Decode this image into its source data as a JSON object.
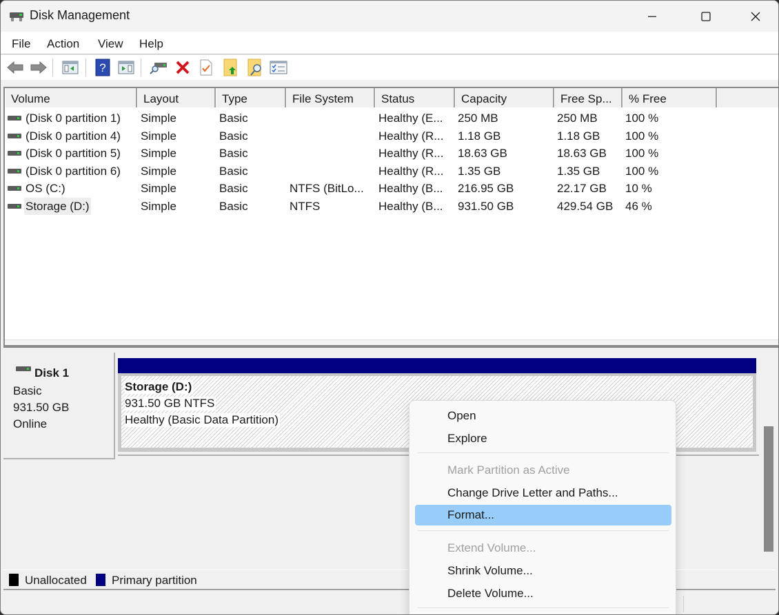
{
  "window": {
    "title": "Disk Management",
    "controls": {
      "minimize": "minimize",
      "maximize": "maximize",
      "close": "close"
    }
  },
  "menubar": {
    "items": [
      {
        "label": "File"
      },
      {
        "label": "Action"
      },
      {
        "label": "View"
      },
      {
        "label": "Help"
      }
    ]
  },
  "toolbar": {
    "buttons": [
      {
        "icon": "back-arrow-icon",
        "tooltip": "Back"
      },
      {
        "icon": "forward-arrow-icon",
        "tooltip": "Forward"
      },
      {
        "icon": "show-hide-console-tree-icon"
      },
      {
        "icon": "help-icon"
      },
      {
        "icon": "show-hide-action-pane-icon"
      },
      {
        "icon": "connect-drive-icon"
      },
      {
        "icon": "delete-icon"
      },
      {
        "icon": "properties-icon"
      },
      {
        "icon": "open-folder-up-icon"
      },
      {
        "icon": "explore-folder-search-icon"
      },
      {
        "icon": "checklist-icon"
      }
    ]
  },
  "volume_list": {
    "columns": [
      "Volume",
      "Layout",
      "Type",
      "File System",
      "Status",
      "Capacity",
      "Free Sp...",
      "% Free"
    ],
    "rows": [
      {
        "volume": "(Disk 0 partition 1)",
        "layout": "Simple",
        "type": "Basic",
        "fs": "",
        "status": "Healthy (E...",
        "capacity": "250 MB",
        "free": "250 MB",
        "pct": "100 %"
      },
      {
        "volume": "(Disk 0 partition 4)",
        "layout": "Simple",
        "type": "Basic",
        "fs": "",
        "status": "Healthy (R...",
        "capacity": "1.18 GB",
        "free": "1.18 GB",
        "pct": "100 %"
      },
      {
        "volume": "(Disk 0 partition 5)",
        "layout": "Simple",
        "type": "Basic",
        "fs": "",
        "status": "Healthy (R...",
        "capacity": "18.63 GB",
        "free": "18.63 GB",
        "pct": "100 %"
      },
      {
        "volume": "(Disk 0 partition 6)",
        "layout": "Simple",
        "type": "Basic",
        "fs": "",
        "status": "Healthy (R...",
        "capacity": "1.35 GB",
        "free": "1.35 GB",
        "pct": "100 %"
      },
      {
        "volume": "OS (C:)",
        "layout": "Simple",
        "type": "Basic",
        "fs": "NTFS (BitLo...",
        "status": "Healthy (B...",
        "capacity": "216.95 GB",
        "free": "22.17 GB",
        "pct": "10 %"
      },
      {
        "volume": "Storage (D:)",
        "layout": "Simple",
        "type": "Basic",
        "fs": "NTFS",
        "status": "Healthy (B...",
        "capacity": "931.50 GB",
        "free": "429.54 GB",
        "pct": "46 %"
      }
    ]
  },
  "disk_pane": {
    "disk": {
      "name": "Disk 1",
      "type": "Basic",
      "size": "931.50 GB",
      "state": "Online"
    },
    "partition": {
      "name": "Storage  (D:)",
      "size_fs": "931.50 GB NTFS",
      "status": "Healthy (Basic Data Partition)",
      "color": "#000080"
    }
  },
  "legend": [
    {
      "label": "Unallocated",
      "color": "#000000"
    },
    {
      "label": "Primary partition",
      "color": "#000080"
    }
  ],
  "context_menu": {
    "items": [
      {
        "label": "Open",
        "disabled": false
      },
      {
        "label": "Explore",
        "disabled": false
      },
      {
        "separator": true
      },
      {
        "label": "Mark Partition as Active",
        "disabled": true
      },
      {
        "label": "Change Drive Letter and Paths...",
        "disabled": false
      },
      {
        "label": "Format...",
        "disabled": false,
        "highlighted": true
      },
      {
        "separator": true
      },
      {
        "label": "Extend Volume...",
        "disabled": true
      },
      {
        "label": "Shrink Volume...",
        "disabled": false
      },
      {
        "label": "Delete Volume...",
        "disabled": false
      },
      {
        "separator": true
      }
    ],
    "highlight_color": "#99cdf9"
  }
}
